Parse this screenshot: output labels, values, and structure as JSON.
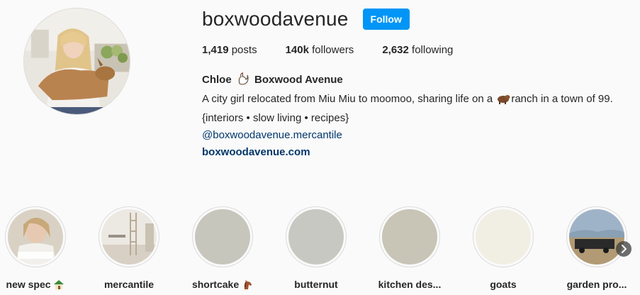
{
  "profile": {
    "username": "boxwoodavenue",
    "follow_label": "Follow",
    "stats": {
      "posts_value": "1,419",
      "posts_label": "posts",
      "followers_value": "140k",
      "followers_label": "followers",
      "following_value": "2,632",
      "following_label": "following"
    },
    "bio": {
      "fullname_prefix": "Chloe",
      "fullname_icon": "rooster-icon",
      "fullname_suffix": "Boxwood Avenue",
      "line1_a": "A city girl relocated from Miu Miu to moomoo, sharing life on a",
      "line1_icon": "cow-icon",
      "line1_b": "ranch in a town of 99.",
      "line2": "{interiors • slow living • recipes}",
      "handle": "@boxwoodavenue.mercantile",
      "website": "boxwoodavenue.com"
    }
  },
  "highlights": [
    {
      "label": "new spec",
      "icon": "house-icon"
    },
    {
      "label": "mercantile"
    },
    {
      "label": "shortcake",
      "icon": "horse-icon"
    },
    {
      "label": "butternut"
    },
    {
      "label": "kitchen des..."
    },
    {
      "label": "goats"
    },
    {
      "label": "garden pro..."
    }
  ],
  "colors": {
    "accent": "#0095f6",
    "link": "#00376b",
    "text": "#262626",
    "background": "#fafafa"
  }
}
